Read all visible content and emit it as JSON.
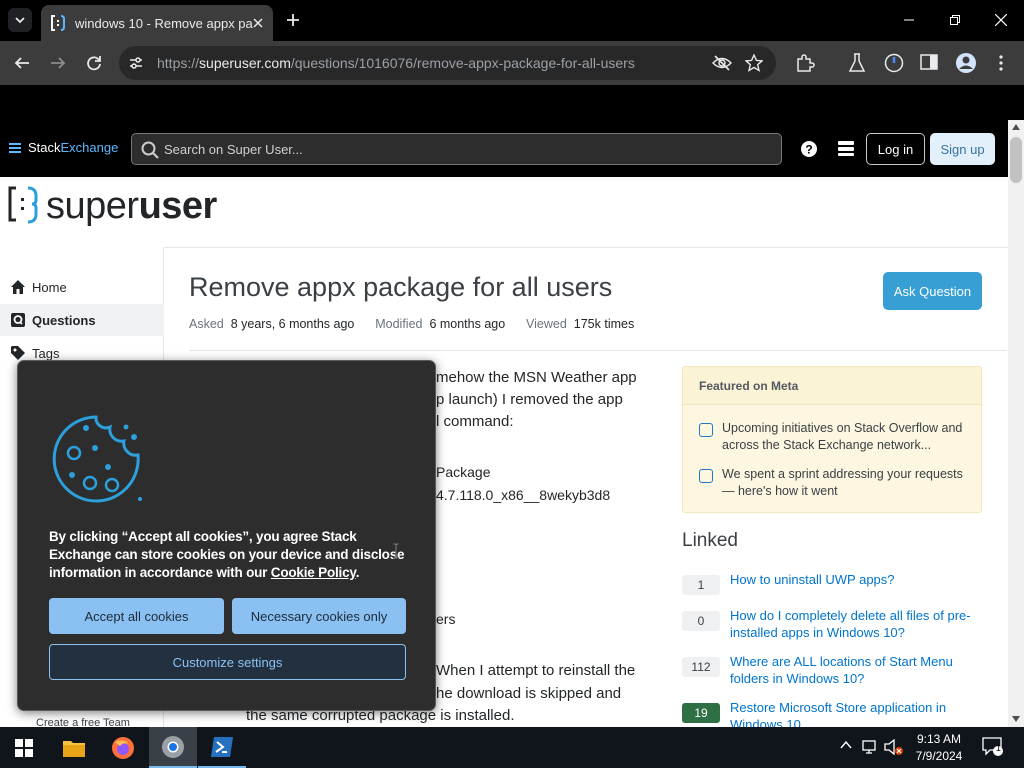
{
  "browser": {
    "tab_title": "windows 10 - Remove appx pa",
    "url_prefix": "https://",
    "url_host": "superuser.com",
    "url_path": "/questions/1016076/remove-appx-package-for-all-users"
  },
  "site_header": {
    "brand_1": "Stack",
    "brand_2": "Exchange",
    "search_placeholder": "Search on Super User...",
    "login_label": "Log in",
    "signup_label": "Sign up"
  },
  "logo": {
    "text_1": "super",
    "text_2": "user"
  },
  "left_nav": {
    "items": [
      {
        "label": "Home"
      },
      {
        "label": "Questions"
      },
      {
        "label": "Tags"
      }
    ],
    "bottom_text": "Create a free Team"
  },
  "question": {
    "title": "Remove appx package for all users",
    "ask_button": "Ask Question",
    "asked_label": "Asked",
    "asked_value": "8 years, 6 months ago",
    "modified_label": "Modified",
    "modified_value": "6 months ago",
    "viewed_label": "Viewed",
    "viewed_value": "175k times",
    "body_lines": [
      "mehow the MSN Weather app",
      "p launch) I removed the app",
      "l command:",
      "Package",
      "4.7.118.0_x86__8wekyb3d8",
      "ers",
      "When I attempt to reinstall the",
      "he download is skipped and",
      "the same corrupted package is installed."
    ]
  },
  "featured_meta": {
    "heading": "Featured on Meta",
    "items": [
      {
        "text": "Upcoming initiatives on Stack Overflow and across the Stack Exchange network..."
      },
      {
        "text": "We spent a sprint addressing your requests — here's how it went"
      }
    ]
  },
  "linked": {
    "heading": "Linked",
    "items": [
      {
        "score": "1",
        "title": "How to uninstall UWP apps?"
      },
      {
        "score": "0",
        "title": "How do I completely delete all files of pre-installed apps in Windows 10?"
      },
      {
        "score": "112",
        "title": "Where are ALL locations of Start Menu folders in Windows 10?"
      },
      {
        "score": "19",
        "title": "Restore Microsoft Store application in Windows 10"
      }
    ]
  },
  "cookie_dialog": {
    "text_main": "By clicking “Accept all cookies”, you agree Stack Exchange can store cookies on your device and disclose information in accordance with our ",
    "policy_link": "Cookie Policy",
    "text_end": ".",
    "accept_all": "Accept all cookies",
    "necessary_only": "Necessary cookies only",
    "customize": "Customize settings"
  },
  "taskbar": {
    "time": "9:13 AM",
    "date": "7/9/2024",
    "notification_count": "1"
  },
  "colors": {
    "accent_blue": "#379fd4",
    "link_blue": "#0074cc",
    "cookie_button": "#8bc1f2",
    "accepted_green": "#2f6f44"
  }
}
